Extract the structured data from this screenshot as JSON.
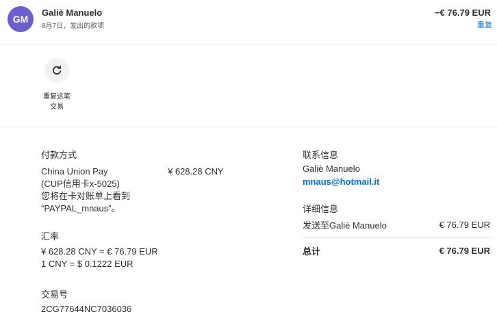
{
  "header": {
    "avatar_initials": "GM",
    "name": "Galiè Manuelo",
    "subtitle": "8月7日，发出的款项",
    "amount": "−€ 76.79 EUR",
    "repeat_link": "重复"
  },
  "action": {
    "icon": "refresh-icon",
    "label_line1": "重复这笔",
    "label_line2": "交易"
  },
  "payment": {
    "heading": "付款方式",
    "method_line1": "China Union Pay",
    "method_line2": "(CUP信用卡x-5025)",
    "method_line3": "您将在卡对账单上看到",
    "method_line4": "“PAYPAL_mnaus”。",
    "amount": "¥ 628.28 CNY"
  },
  "exchange": {
    "heading": "汇率",
    "line1": "¥ 628.28 CNY = € 76.79 EUR",
    "line2": "1 CNY = $ 0.1222 EUR"
  },
  "transaction": {
    "heading": "交易号",
    "id": "2CG77644NC7036036"
  },
  "contact": {
    "heading": "联系信息",
    "name": "Galiè Manuelo",
    "email": "mnaus@hotmail.it"
  },
  "details": {
    "heading": "详细信息",
    "sent_to_label": "发送至Galiè Manuelo",
    "sent_to_amount": "€ 76.79 EUR",
    "total_label": "总计",
    "total_amount": "€ 76.79 EUR"
  },
  "colors": {
    "avatar": "#6c5ecf",
    "link": "#0070e0",
    "text": "#2c2e2f"
  }
}
